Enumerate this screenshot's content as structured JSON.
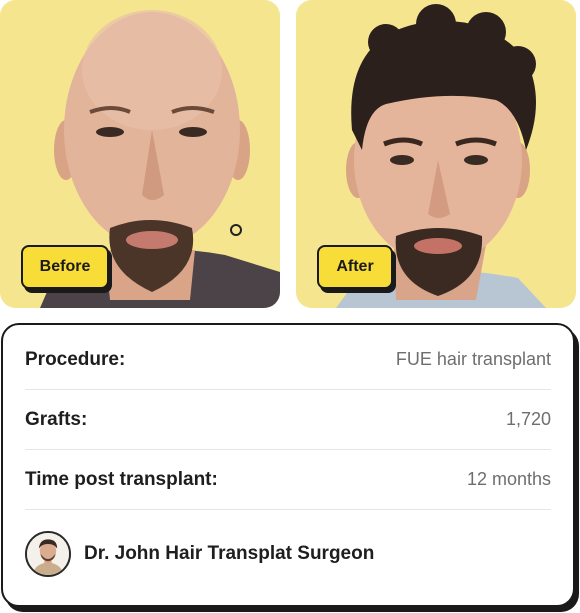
{
  "photos": {
    "before": {
      "label": "Before",
      "alt": "Patient before hair transplant"
    },
    "after": {
      "label": "After",
      "alt": "Patient after hair transplant"
    }
  },
  "details": [
    {
      "label": "Procedure:",
      "value": "FUE hair transplant"
    },
    {
      "label": "Grafts:",
      "value": "1,720"
    },
    {
      "label": "Time post transplant:",
      "value": "12 months"
    }
  ],
  "surgeon": {
    "name": "Dr. John Hair Transplat Surgeon",
    "avatar_icon": "surgeon-avatar"
  },
  "colors": {
    "background": "#f5e58f",
    "pill": "#f8dd38",
    "border": "#1a1a1a",
    "value_text": "#6e6e6e"
  }
}
